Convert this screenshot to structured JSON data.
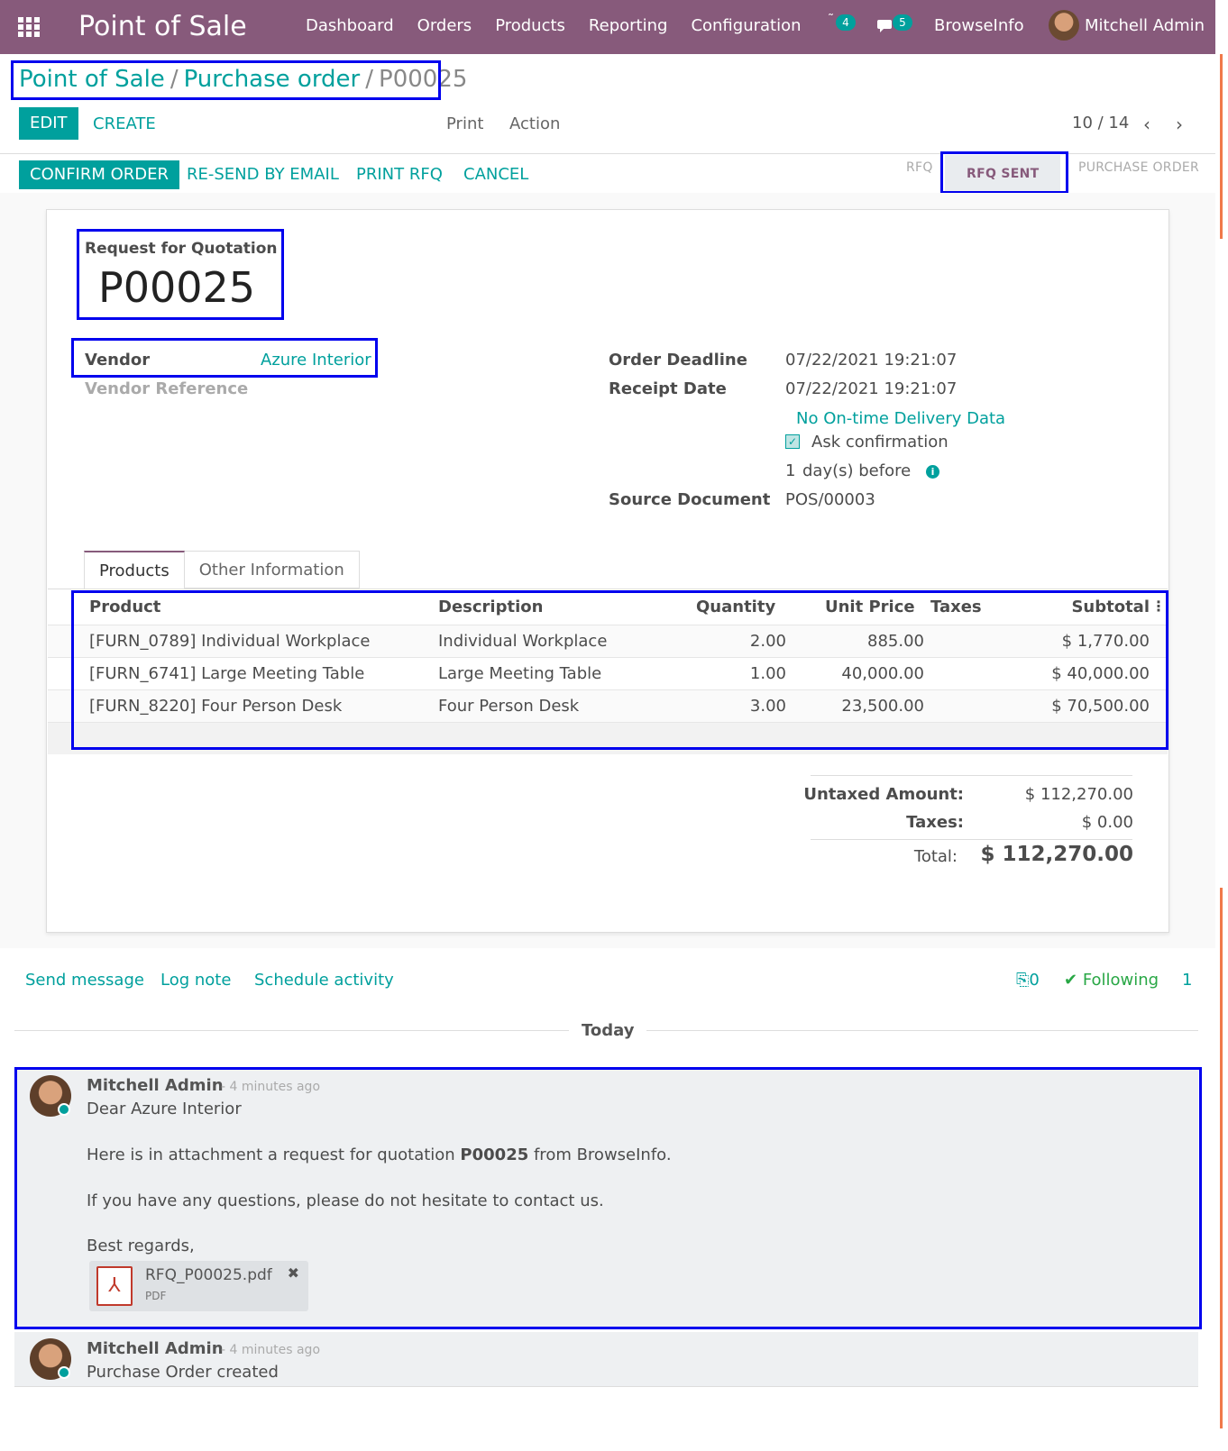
{
  "topbar": {
    "app_name": "Point of Sale",
    "menu": [
      "Dashboard",
      "Orders",
      "Products",
      "Reporting",
      "Configuration"
    ],
    "activity_count": "4",
    "messages_count": "5",
    "company": "BrowseInfo",
    "user": "Mitchell Admin"
  },
  "breadcrumb": {
    "root": "Point of Sale",
    "parent": "Purchase order",
    "current": "P00025"
  },
  "control_panel": {
    "edit": "EDIT",
    "create": "CREATE",
    "print": "Print",
    "action": "Action",
    "pager": "10 / 14"
  },
  "header_buttons": {
    "confirm": "CONFIRM ORDER",
    "resend": "RE-SEND BY EMAIL",
    "print_rfq": "PRINT RFQ",
    "cancel": "CANCEL"
  },
  "statusbar": {
    "steps": [
      "RFQ",
      "RFQ SENT",
      "PURCHASE ORDER"
    ],
    "active": "RFQ SENT"
  },
  "form": {
    "doc_type": "Request for Quotation",
    "name": "P00025",
    "vendor_label": "Vendor",
    "vendor": "Azure Interior",
    "vendor_ref_label": "Vendor Reference",
    "order_deadline_label": "Order Deadline",
    "order_deadline": "07/22/2021 19:21:07",
    "receipt_date_label": "Receipt Date",
    "receipt_date": "07/22/2021 19:21:07",
    "on_time": "No On-time Delivery Data",
    "ask_confirmation": "Ask confirmation",
    "ask_confirmation_checked": true,
    "days_before_value": "1",
    "days_before_label": "day(s) before",
    "source_label": "Source Document",
    "source": "POS/00003"
  },
  "tabs": [
    "Products",
    "Other Information"
  ],
  "table": {
    "headers": [
      "Product",
      "Description",
      "Quantity",
      "Unit Price",
      "Taxes",
      "Subtotal"
    ],
    "rows": [
      {
        "product": "[FURN_0789] Individual Workplace",
        "description": "Individual Workplace",
        "qty": "2.00",
        "price": "885.00",
        "taxes": "",
        "subtotal": "$ 1,770.00"
      },
      {
        "product": "[FURN_6741] Large Meeting Table",
        "description": "Large Meeting Table",
        "qty": "1.00",
        "price": "40,000.00",
        "taxes": "",
        "subtotal": "$ 40,000.00"
      },
      {
        "product": "[FURN_8220] Four Person Desk",
        "description": "Four Person Desk",
        "qty": "3.00",
        "price": "23,500.00",
        "taxes": "",
        "subtotal": "$ 70,500.00"
      }
    ]
  },
  "totals": {
    "untaxed_label": "Untaxed Amount:",
    "untaxed": "$ 112,270.00",
    "taxes_label": "Taxes:",
    "taxes": "$ 0.00",
    "total_label": "Total:",
    "total": "$ 112,270.00"
  },
  "chatter": {
    "send_message": "Send message",
    "log_note": "Log note",
    "schedule_activity": "Schedule activity",
    "attachments": "0",
    "following": "Following",
    "followers": "1",
    "today": "Today",
    "messages": [
      {
        "author": "Mitchell Admin",
        "time": "- 4 minutes ago",
        "line1": "Dear Azure Interior",
        "line2_pre": "Here is in attachment a request for quotation ",
        "line2_bold": "P00025",
        "line2_post": " from BrowseInfo.",
        "line3": "If you have any questions, please do not hesitate to contact us.",
        "line4": "Best regards,",
        "attachment_name": "RFQ_P00025.pdf",
        "attachment_type": "PDF"
      },
      {
        "author": "Mitchell Admin",
        "time": "- 4 minutes ago",
        "body": "Purchase Order created"
      }
    ]
  },
  "colors": {
    "brand": "#875a7b",
    "accent": "#00a09d",
    "highlight_box": "#0000ee"
  }
}
